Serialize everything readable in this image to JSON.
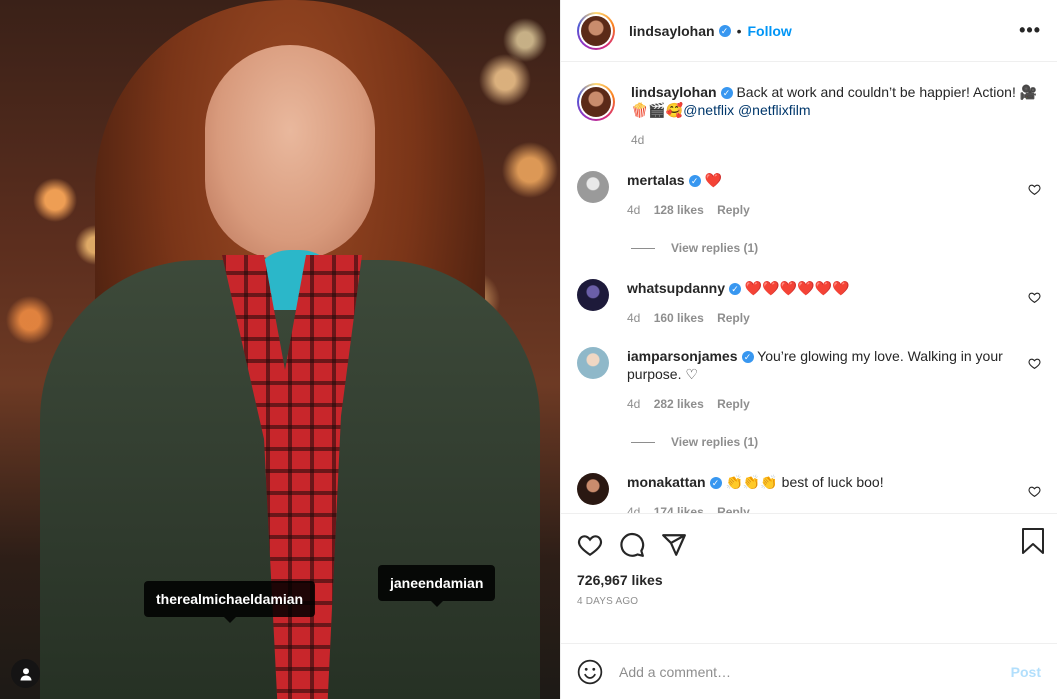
{
  "post": {
    "username": "lindsaylohan",
    "follow_label": "Follow",
    "more_label": "•••",
    "caption_text": "Back at work and couldn’t be happier! Action! 🎥",
    "caption_emojis": "🍿🎬🥰",
    "caption_mentions": "@netflix @netflixfilm",
    "caption_age": "4d"
  },
  "photo_tags": [
    "therealmichaeldamian",
    "janeendamian"
  ],
  "comments": [
    {
      "user": "mertalas",
      "text": "❤️",
      "age": "4d",
      "likes": "128 likes",
      "reply": "Reply",
      "view_replies": "View replies (1)"
    },
    {
      "user": "whatsupdanny",
      "text": "❤️❤️❤️❤️❤️❤️",
      "age": "4d",
      "likes": "160 likes",
      "reply": "Reply"
    },
    {
      "user": "iamparsonjames",
      "text": "You’re glowing my love. Walking in your purpose. ♡",
      "age": "4d",
      "likes": "282 likes",
      "reply": "Reply",
      "view_replies": "View replies (1)"
    },
    {
      "user": "monakattan",
      "text": "👏👏👏 best of luck boo!",
      "age": "4d",
      "likes": "174 likes",
      "reply": "Reply"
    }
  ],
  "actions": {
    "likes_count": "726,967 likes",
    "posted_ago": "4 DAYS AGO",
    "comment_placeholder": "Add a comment…",
    "post_label": "Post"
  },
  "icons": [
    "heart-icon",
    "comment-icon",
    "share-icon",
    "bookmark-icon",
    "emoji-icon",
    "user-tag-icon",
    "more-options-icon",
    "verified-badge-icon"
  ],
  "colors": {
    "accent": "#0095f6",
    "verified": "#3897f0",
    "muted": "#8e8e8e",
    "heart": "#e0245e",
    "post_disabled": "#b2dffc"
  }
}
